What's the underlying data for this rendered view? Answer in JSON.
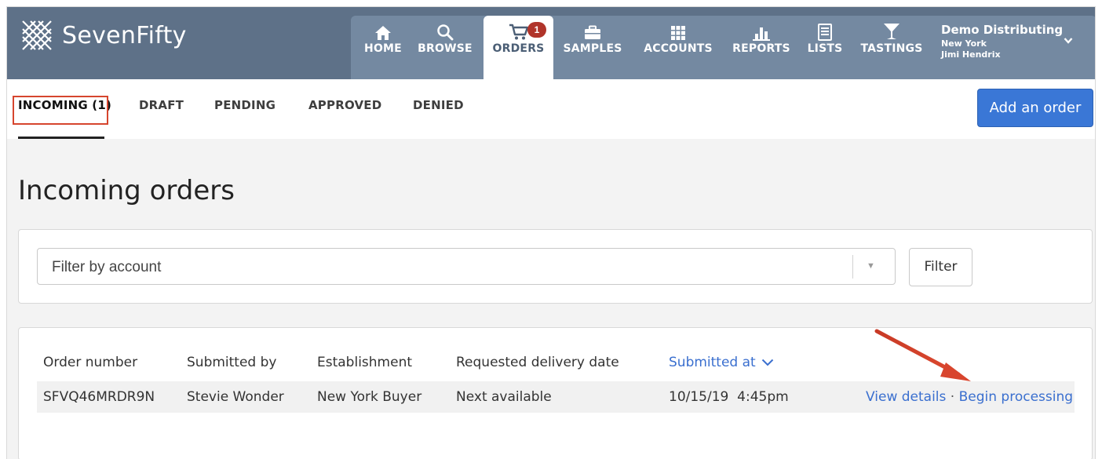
{
  "brand": {
    "name": "SevenFifty"
  },
  "nav": {
    "items": [
      {
        "label": "HOME",
        "icon": "home-icon"
      },
      {
        "label": "BROWSE",
        "icon": "search-icon"
      },
      {
        "label": "ORDERS",
        "icon": "cart-icon",
        "badge": "1",
        "active": true
      },
      {
        "label": "SAMPLES",
        "icon": "briefcase-icon"
      },
      {
        "label": "ACCOUNTS",
        "icon": "grid-icon"
      },
      {
        "label": "REPORTS",
        "icon": "bar-chart-icon"
      },
      {
        "label": "LISTS",
        "icon": "list-icon"
      },
      {
        "label": "TASTINGS",
        "icon": "cocktail-icon"
      }
    ]
  },
  "user": {
    "company": "Demo Distributing",
    "region": "New York",
    "name": "Jimi Hendrix"
  },
  "tabs": [
    {
      "label": "INCOMING (1)",
      "active": true
    },
    {
      "label": "DRAFT"
    },
    {
      "label": "PENDING"
    },
    {
      "label": "APPROVED"
    },
    {
      "label": "DENIED"
    }
  ],
  "add_order_label": "Add an order",
  "page_title": "Incoming orders",
  "filter": {
    "placeholder": "Filter by account",
    "button_label": "Filter"
  },
  "table": {
    "columns": [
      "Order number",
      "Submitted by",
      "Establishment",
      "Requested delivery date",
      "Submitted at"
    ],
    "sorted_column": "Submitted at",
    "rows": [
      {
        "order_number": "SFVQ46MRDR9N",
        "submitted_by": "Stevie Wonder",
        "establishment": "New York Buyer",
        "delivery_date": "Next available",
        "submitted_at": "10/15/19  4:45pm",
        "actions": {
          "view": "View details",
          "separator": "·",
          "process": "Begin processing"
        }
      }
    ]
  },
  "colors": {
    "nav_bg": "#5e7188",
    "nav_panel": "#7489a1",
    "accent": "#3a77d6",
    "link": "#3a6fcf",
    "badge": "#b0342a",
    "annotation": "#d6452e"
  }
}
